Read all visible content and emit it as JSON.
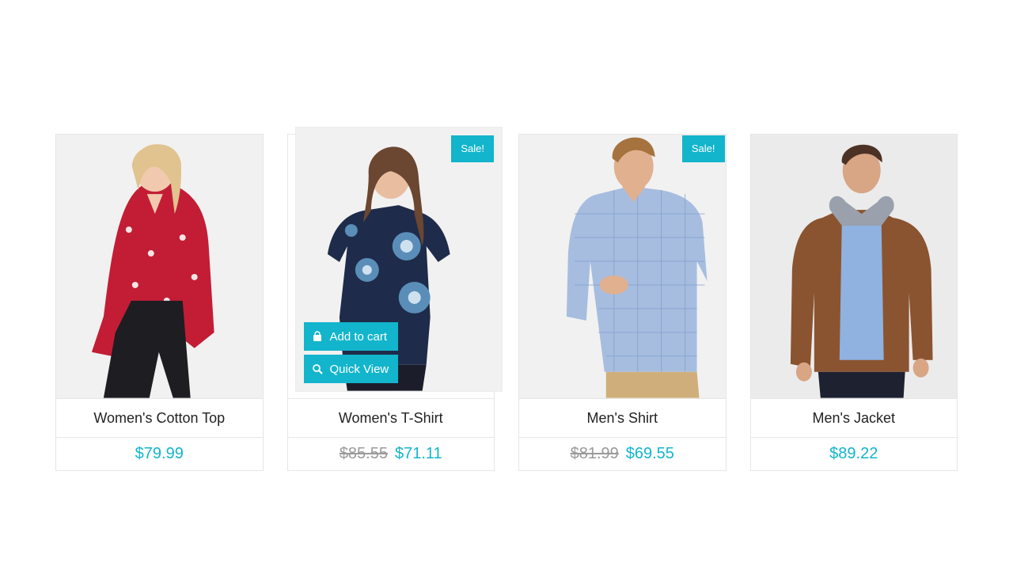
{
  "accent_color": "#12b5cb",
  "products": [
    {
      "name": "Women's Cotton Top",
      "price": "$79.99",
      "old_price": "",
      "sale_badge": "",
      "image_icon": "woman-floral-top-photo"
    },
    {
      "name": "Women's T-Shirt",
      "price": "$71.11",
      "old_price": "$85.55",
      "sale_badge": "Sale!",
      "image_icon": "woman-navy-tshirt-photo",
      "hover_actions": {
        "add_to_cart": "Add to cart",
        "quick_view": "Quick View"
      }
    },
    {
      "name": "Men's Shirt",
      "price": "$69.55",
      "old_price": "$81.99",
      "sale_badge": "Sale!",
      "image_icon": "man-checked-shirt-photo"
    },
    {
      "name": "Men's Jacket",
      "price": "$89.22",
      "old_price": "",
      "sale_badge": "",
      "image_icon": "man-leather-jacket-photo"
    }
  ]
}
